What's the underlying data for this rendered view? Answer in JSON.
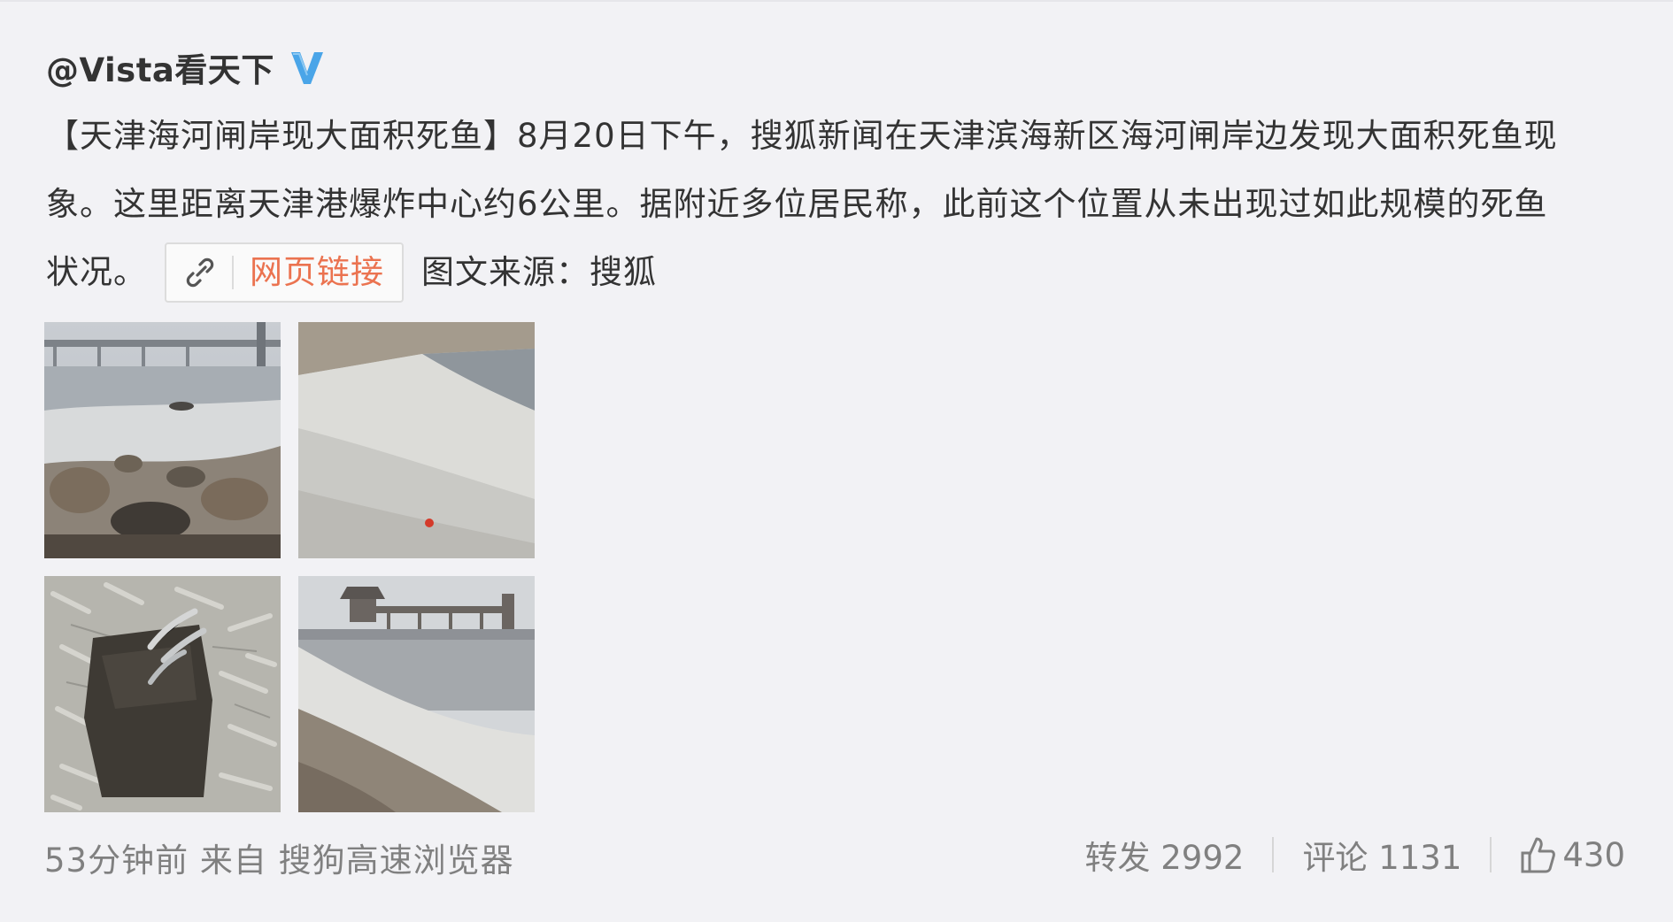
{
  "post": {
    "author": "@Vista看天下",
    "verified_icon": "verified-v-icon",
    "text_line1": "【天津海河闸岸现大面积死鱼】8月20日下午，搜狐新闻在天津滨海新区海河闸岸边发现大面积死鱼现",
    "text_line2": "象。这里距离天津港爆炸中心约6公里。据附近多位居民称，此前这个位置从未出现过如此规模的死鱼",
    "text_line3_start": "状况。",
    "link_label": "网页链接",
    "link_icon": "link-icon",
    "source_text": "图文来源：搜狐"
  },
  "footer": {
    "meta": "53分钟前  来自 搜狗高速浏览器",
    "repost": "转发 2992",
    "comment": "评论 1131",
    "like": "430",
    "like_icon": "thumbs-up-icon"
  },
  "colors": {
    "background": "#f2f2f5",
    "text": "#333333",
    "link": "#eb7350",
    "meta": "#808080",
    "verified": "#4aa5e8"
  }
}
